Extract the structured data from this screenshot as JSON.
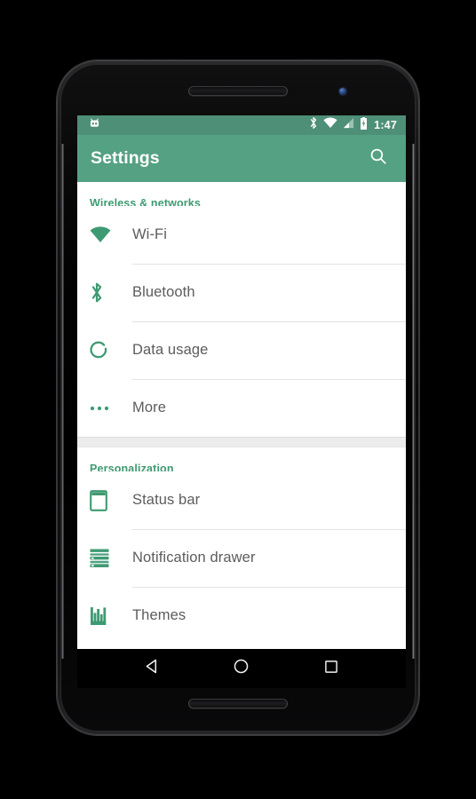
{
  "device": {
    "type": "android-phone",
    "components": [
      "earpiece-grille",
      "front-camera",
      "bottom-speaker-grille"
    ]
  },
  "status_bar": {
    "background_color": "#4e8f77",
    "left_icons": [
      {
        "name": "cyanogenmod-robot-icon",
        "label": "CyanogenMod"
      }
    ],
    "right_icons": [
      {
        "name": "bluetooth-icon",
        "label": "Bluetooth"
      },
      {
        "name": "wifi-icon",
        "label": "Wi-Fi signal"
      },
      {
        "name": "cellular-signal-icon",
        "label": "Cellular signal"
      },
      {
        "name": "battery-charging-icon",
        "label": "Battery charging"
      }
    ],
    "clock": "1:47"
  },
  "toolbar": {
    "title": "Settings",
    "background_color": "#54a183",
    "search_label": "Search"
  },
  "accent_color": "#3e9a72",
  "icon_color": "#3e9a72",
  "sections": [
    {
      "header": "Wireless & networks",
      "items": [
        {
          "label": "Wi-Fi",
          "icon": "wifi-icon"
        },
        {
          "label": "Bluetooth",
          "icon": "bluetooth-icon"
        },
        {
          "label": "Data usage",
          "icon": "data-usage-icon"
        },
        {
          "label": "More",
          "icon": "more-dots-icon"
        }
      ]
    },
    {
      "header": "Personalization",
      "items": [
        {
          "label": "Status bar",
          "icon": "status-bar-icon"
        },
        {
          "label": "Notification drawer",
          "icon": "notification-drawer-icon"
        },
        {
          "label": "Themes",
          "icon": "themes-icon"
        }
      ]
    }
  ],
  "nav_bar": {
    "background_color": "#000000",
    "buttons": [
      {
        "name": "back-button",
        "label": "Back",
        "icon": "triangle-left-icon"
      },
      {
        "name": "home-button",
        "label": "Home",
        "icon": "circle-icon"
      },
      {
        "name": "recents-button",
        "label": "Recents",
        "icon": "square-icon"
      }
    ]
  }
}
